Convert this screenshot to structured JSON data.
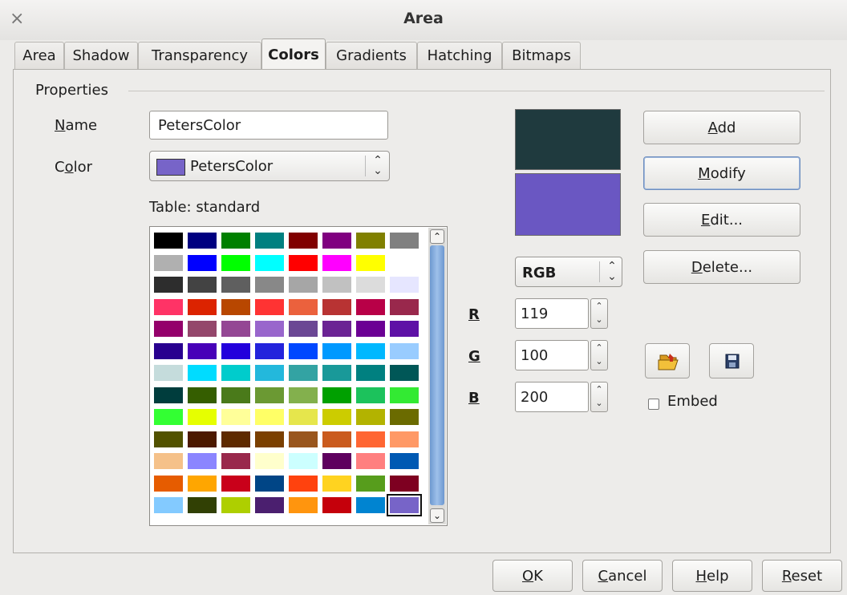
{
  "window": {
    "title": "Area",
    "close_glyph": "×"
  },
  "tabs": [
    {
      "label": "Area",
      "active": false
    },
    {
      "label": "Shadow",
      "active": false
    },
    {
      "label": "Transparency",
      "active": false
    },
    {
      "label": "Colors",
      "active": true
    },
    {
      "label": "Gradients",
      "active": false
    },
    {
      "label": "Hatching",
      "active": false
    },
    {
      "label": "Bitmaps",
      "active": false
    }
  ],
  "properties": {
    "group_label": "Properties",
    "name_label_first": "N",
    "name_label_rest": "ame",
    "name_value": "PetersColor",
    "color_label_first": "C",
    "color_label_u": "o",
    "color_label_rest": "lor",
    "color_value": "PetersColor",
    "color_swatch": "#7764c8",
    "table_label": "Table: standard"
  },
  "palette": [
    "#000000",
    "#000080",
    "#008000",
    "#008080",
    "#800000",
    "#800080",
    "#808000",
    "#808080",
    "#b0b0b0",
    "#0000ff",
    "#00ff00",
    "#00ffff",
    "#ff0000",
    "#ff00ff",
    "#ffff00",
    "#ffffff",
    "#2d2d2d",
    "#434343",
    "#5f5f5f",
    "#888888",
    "#a6a6a6",
    "#c1c1c1",
    "#dcdcdc",
    "#e6e6ff",
    "#ff3366",
    "#dc2300",
    "#b84700",
    "#ff3333",
    "#eb613d",
    "#b83333",
    "#b80047",
    "#99284c",
    "#94006b",
    "#94476b",
    "#944794",
    "#9966cc",
    "#6b4794",
    "#6b2394",
    "#6b0094",
    "#5e11a6",
    "#28008f",
    "#4700b8",
    "#2300dc",
    "#2323dc",
    "#0047ff",
    "#0099ff",
    "#00b8ff",
    "#99ccff",
    "#c5dcdc",
    "#00dcff",
    "#00cccc",
    "#23b8dc",
    "#33a3a3",
    "#199999",
    "#008080",
    "#005757",
    "#003d3d",
    "#355e00",
    "#4a7a1a",
    "#6b9933",
    "#83b04d",
    "#00a000",
    "#1cc25c",
    "#33ea33",
    "#33ff33",
    "#e6ff00",
    "#ffff99",
    "#ffff66",
    "#e6e64c",
    "#cccc00",
    "#b3b300",
    "#6b6b00",
    "#525200",
    "#4c1900",
    "#5e2a00",
    "#7b4000",
    "#99561e",
    "#ca5b1e",
    "#ff6633",
    "#ff9966",
    "#f5c189",
    "#8b85ff",
    "#99284c",
    "#ffffcc",
    "#ccffff",
    "#5e005e",
    "#ff7f7f",
    "#0059b3",
    "#e65c00",
    "#ffa600",
    "#c9001a",
    "#004586",
    "#ff420e",
    "#ffd320",
    "#579d1c",
    "#7e0021",
    "#83caff",
    "#314004",
    "#aecf00",
    "#4b1f6f",
    "#ff950e",
    "#c5000b",
    "#0084d1",
    "#7764c8"
  ],
  "selected_palette_index": 103,
  "preview": {
    "old_color": "#1f3a3e",
    "new_color": "#6a57c2"
  },
  "color_model": {
    "value": "RGB"
  },
  "rgb": {
    "r_label": "R",
    "g_label": "G",
    "b_label": "B",
    "r": "119",
    "g": "100",
    "b": "200"
  },
  "buttons": {
    "add_u": "A",
    "add_rest": "dd",
    "modify_u": "M",
    "modify_rest": "odify",
    "edit_u": "E",
    "edit_rest": "dit...",
    "delete_u": "D",
    "delete_rest": "elete...",
    "embed_label": "Embed"
  },
  "footer": {
    "ok_u": "O",
    "ok_rest": "K",
    "cancel_u": "C",
    "cancel_rest": "ancel",
    "help_u": "H",
    "help_rest": "elp",
    "reset_u": "R",
    "reset_rest": "eset"
  }
}
